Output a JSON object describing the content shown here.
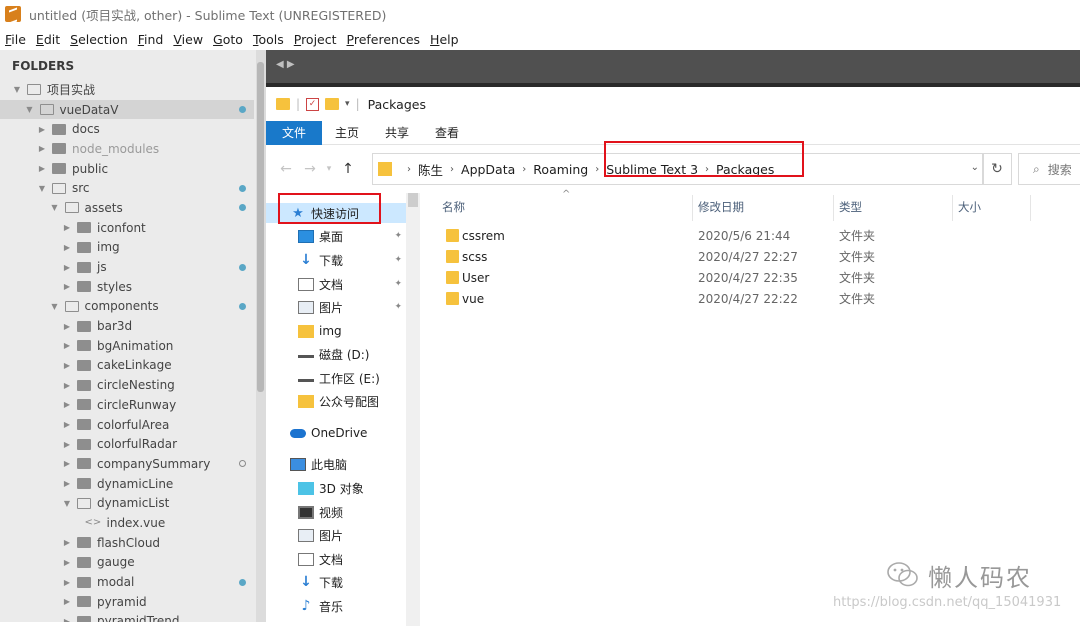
{
  "window": {
    "title": "untitled (项目实战, other) - Sublime Text (UNREGISTERED)"
  },
  "menu": [
    "File",
    "Edit",
    "Selection",
    "Find",
    "View",
    "Goto",
    "Tools",
    "Project",
    "Preferences",
    "Help"
  ],
  "sidebar": {
    "header": "FOLDERS",
    "items": [
      {
        "label": "项目实战",
        "depth": 0,
        "kind": "folder",
        "open": true,
        "selected": false,
        "dim": false,
        "dot": ""
      },
      {
        "label": "vueDataV",
        "depth": 1,
        "kind": "folder",
        "open": true,
        "selected": true,
        "dim": false,
        "dot": "blue"
      },
      {
        "label": "docs",
        "depth": 2,
        "kind": "folder",
        "open": false,
        "selected": false,
        "dim": false,
        "dot": ""
      },
      {
        "label": "node_modules",
        "depth": 2,
        "kind": "folder",
        "open": false,
        "selected": false,
        "dim": true,
        "dot": ""
      },
      {
        "label": "public",
        "depth": 2,
        "kind": "folder",
        "open": false,
        "selected": false,
        "dim": false,
        "dot": ""
      },
      {
        "label": "src",
        "depth": 2,
        "kind": "folder",
        "open": true,
        "selected": false,
        "dim": false,
        "dot": "blue"
      },
      {
        "label": "assets",
        "depth": 3,
        "kind": "folder",
        "open": true,
        "selected": false,
        "dim": false,
        "dot": "blue"
      },
      {
        "label": "iconfont",
        "depth": 4,
        "kind": "folder",
        "open": false,
        "selected": false,
        "dim": false,
        "dot": ""
      },
      {
        "label": "img",
        "depth": 4,
        "kind": "folder",
        "open": false,
        "selected": false,
        "dim": false,
        "dot": ""
      },
      {
        "label": "js",
        "depth": 4,
        "kind": "folder",
        "open": false,
        "selected": false,
        "dim": false,
        "dot": "blue"
      },
      {
        "label": "styles",
        "depth": 4,
        "kind": "folder",
        "open": false,
        "selected": false,
        "dim": false,
        "dot": ""
      },
      {
        "label": "components",
        "depth": 3,
        "kind": "folder",
        "open": true,
        "selected": false,
        "dim": false,
        "dot": "blue"
      },
      {
        "label": "bar3d",
        "depth": 4,
        "kind": "folder",
        "open": false,
        "selected": false,
        "dim": false,
        "dot": ""
      },
      {
        "label": "bgAnimation",
        "depth": 4,
        "kind": "folder",
        "open": false,
        "selected": false,
        "dim": false,
        "dot": ""
      },
      {
        "label": "cakeLinkage",
        "depth": 4,
        "kind": "folder",
        "open": false,
        "selected": false,
        "dim": false,
        "dot": ""
      },
      {
        "label": "circleNesting",
        "depth": 4,
        "kind": "folder",
        "open": false,
        "selected": false,
        "dim": false,
        "dot": ""
      },
      {
        "label": "circleRunway",
        "depth": 4,
        "kind": "folder",
        "open": false,
        "selected": false,
        "dim": false,
        "dot": ""
      },
      {
        "label": "colorfulArea",
        "depth": 4,
        "kind": "folder",
        "open": false,
        "selected": false,
        "dim": false,
        "dot": ""
      },
      {
        "label": "colorfulRadar",
        "depth": 4,
        "kind": "folder",
        "open": false,
        "selected": false,
        "dim": false,
        "dot": ""
      },
      {
        "label": "companySummary",
        "depth": 4,
        "kind": "folder",
        "open": false,
        "selected": false,
        "dim": false,
        "dot": "hollow"
      },
      {
        "label": "dynamicLine",
        "depth": 4,
        "kind": "folder",
        "open": false,
        "selected": false,
        "dim": false,
        "dot": ""
      },
      {
        "label": "dynamicList",
        "depth": 4,
        "kind": "folder",
        "open": true,
        "selected": false,
        "dim": false,
        "dot": ""
      },
      {
        "label": "index.vue",
        "depth": 5,
        "kind": "file",
        "open": false,
        "selected": false,
        "dim": false,
        "dot": ""
      },
      {
        "label": "flashCloud",
        "depth": 4,
        "kind": "folder",
        "open": false,
        "selected": false,
        "dim": false,
        "dot": ""
      },
      {
        "label": "gauge",
        "depth": 4,
        "kind": "folder",
        "open": false,
        "selected": false,
        "dim": false,
        "dot": ""
      },
      {
        "label": "modal",
        "depth": 4,
        "kind": "folder",
        "open": false,
        "selected": false,
        "dim": false,
        "dot": "blue"
      },
      {
        "label": "pyramid",
        "depth": 4,
        "kind": "folder",
        "open": false,
        "selected": false,
        "dim": false,
        "dot": ""
      },
      {
        "label": "pyramidTrend",
        "depth": 4,
        "kind": "folder",
        "open": false,
        "selected": false,
        "dim": false,
        "dot": ""
      }
    ]
  },
  "explorer": {
    "window_title": "Packages",
    "ribbon_tabs": [
      "文件",
      "主页",
      "共享",
      "查看"
    ],
    "breadcrumb": [
      "陈生",
      "AppData",
      "Roaming",
      "Sublime Text 3",
      "Packages"
    ],
    "search_placeholder": "搜索",
    "columns": {
      "name": "名称",
      "date": "修改日期",
      "type": "类型",
      "size": "大小"
    },
    "nav_items": [
      {
        "label": "快速访问",
        "icon": "star-icon",
        "pinned": false,
        "active": true
      },
      {
        "label": "桌面",
        "icon": "desktop-icon",
        "pinned": true,
        "active": false
      },
      {
        "label": "下载",
        "icon": "download-icon",
        "pinned": true,
        "active": false
      },
      {
        "label": "文档",
        "icon": "document-icon",
        "pinned": true,
        "active": false
      },
      {
        "label": "图片",
        "icon": "picture-icon",
        "pinned": true,
        "active": false
      },
      {
        "label": "img",
        "icon": "folder-icon",
        "pinned": false,
        "active": false
      },
      {
        "label": "磁盘 (D:)",
        "icon": "drive-icon",
        "pinned": false,
        "active": false
      },
      {
        "label": "工作区 (E:)",
        "icon": "drive-icon",
        "pinned": false,
        "active": false
      },
      {
        "label": "公众号配图",
        "icon": "folder-icon",
        "pinned": false,
        "active": false
      },
      {
        "label": "OneDrive",
        "icon": "cloud-icon",
        "pinned": false,
        "active": false
      },
      {
        "label": "此电脑",
        "icon": "computer-icon",
        "pinned": false,
        "active": false
      },
      {
        "label": "3D 对象",
        "icon": "cube-icon",
        "pinned": false,
        "active": false
      },
      {
        "label": "视频",
        "icon": "video-icon",
        "pinned": false,
        "active": false
      },
      {
        "label": "图片",
        "icon": "picture-icon",
        "pinned": false,
        "active": false
      },
      {
        "label": "文档",
        "icon": "document-icon",
        "pinned": false,
        "active": false
      },
      {
        "label": "下载",
        "icon": "download-icon",
        "pinned": false,
        "active": false
      },
      {
        "label": "音乐",
        "icon": "music-icon",
        "pinned": false,
        "active": false
      }
    ],
    "files": [
      {
        "name": "cssrem",
        "date": "2020/5/6 21:44",
        "type": "文件夹"
      },
      {
        "name": "scss",
        "date": "2020/4/27 22:27",
        "type": "文件夹"
      },
      {
        "name": "User",
        "date": "2020/4/27 22:35",
        "type": "文件夹"
      },
      {
        "name": "vue",
        "date": "2020/4/27 22:22",
        "type": "文件夹"
      }
    ]
  },
  "watermark": {
    "text": "懒人码农",
    "url": "https://blog.csdn.net/qq_15041931"
  },
  "colors": {
    "highlight_box": "#e1121b",
    "ribbon_file": "#1979ca",
    "folder": "#f6c23d",
    "modified_dot": "#5aa7c6"
  }
}
